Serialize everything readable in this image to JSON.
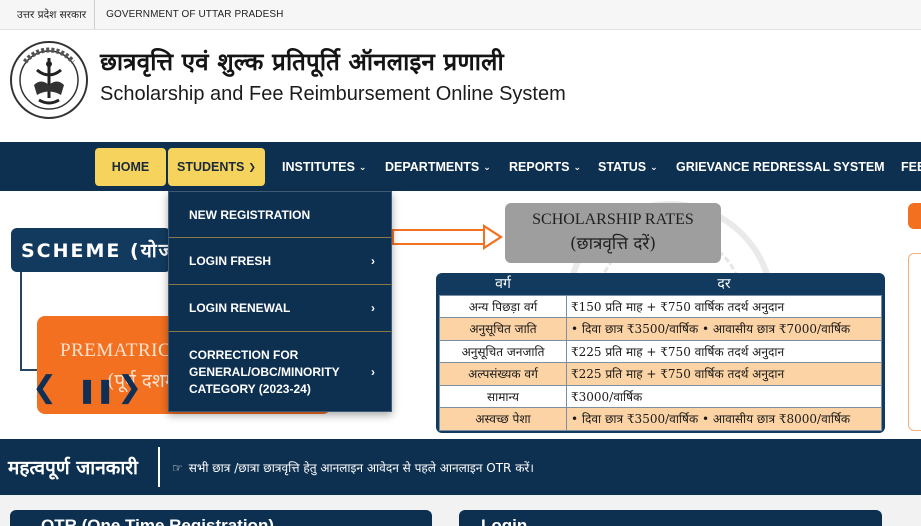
{
  "topbar": {
    "state_hi": "उत्तर प्रदेश सरकार",
    "state_en": "GOVERNMENT OF UTTAR PRADESH"
  },
  "header": {
    "emblem_icon": "up-government-emblem-icon",
    "emblem_text": "उत्तर प्रदेश सरकार",
    "title_hi": "छात्रवृत्ति एवं शुल्क प्रतिपूर्ति ऑनलाइन प्रणाली",
    "title_en": "Scholarship and Fee Reimbursement Online System"
  },
  "nav": {
    "items": [
      {
        "label": "HOME"
      },
      {
        "label": "STUDENTS"
      },
      {
        "label": "INSTITUTES"
      },
      {
        "label": "DEPARTMENTS"
      },
      {
        "label": "REPORTS"
      },
      {
        "label": "STATUS"
      },
      {
        "label": "GRIEVANCE REDRESSAL SYSTEM"
      },
      {
        "label": "FEE"
      }
    ],
    "active_color": "#f5d35c",
    "bg_color": "#0e3050"
  },
  "students_menu": {
    "items": [
      {
        "label": "NEW REGISTRATION"
      },
      {
        "label": "LOGIN FRESH"
      },
      {
        "label": "LOGIN RENEWAL"
      },
      {
        "label": "CORRECTION FOR GENERAL/OBC/MINORITY CATEGORY (2023-24)"
      }
    ]
  },
  "slider": {
    "scheme_label": "SCHEME (योजना)",
    "prematric_en": "PREMATRIC",
    "prematric_hi": "(पूर्व दशम)",
    "accent": "#f37021"
  },
  "rates": {
    "title_en": "SCHOLARSHIP RATES",
    "title_hi": "(छात्रवृत्ति दरें)",
    "col_category": "वर्ग",
    "col_rate": "दर",
    "rows": [
      {
        "category": "अन्य पिछड़ा वर्ग",
        "rate": "₹150 प्रति माह + ₹750 वार्षिक तदर्थ अनुदान"
      },
      {
        "category": "अनुसूचित जाति",
        "rate": "• दिवा छात्र ₹3500/वार्षिक • आवासीय छात्र ₹7000/वार्षिक"
      },
      {
        "category": "अनुसूचित जनजाति",
        "rate": "₹225 प्रति माह + ₹750 वार्षिक तदर्थ अनुदान"
      },
      {
        "category": "अल्पसंख्यक वर्ग",
        "rate": "₹225 प्रति माह + ₹750 वार्षिक तदर्थ अनुदान"
      },
      {
        "category": "सामान्य",
        "rate": "₹3000/वार्षिक"
      },
      {
        "category": "अस्वच्छ पेशा",
        "rate": "• दिवा छात्र ₹3500/वार्षिक • आवासीय छात्र ₹8000/वार्षिक"
      }
    ]
  },
  "info": {
    "label": "महत्वपूर्ण जानकारी",
    "message": "सभी छात्र /छात्रा छात्रवृत्ति हेतु आनलाइन आवेदन से पहले आनलाइन OTR करें।"
  },
  "panels": {
    "otr": "OTR (One Time Registration)",
    "login": "Login"
  }
}
